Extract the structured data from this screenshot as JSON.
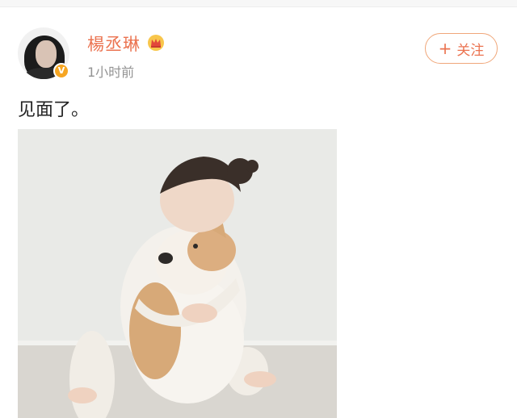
{
  "post": {
    "username": "楊丞琳",
    "timestamp": "1小时前",
    "follow_label": "关注",
    "follow_icon": "plus",
    "text": "见面了。",
    "verified_badge": "V",
    "badge_icon": "crown-icon"
  },
  "colors": {
    "accent": "#eb7350",
    "badge": "#f6a623",
    "muted": "#939393"
  },
  "photo": {
    "subject": "child-hugging-shiba-dog"
  }
}
